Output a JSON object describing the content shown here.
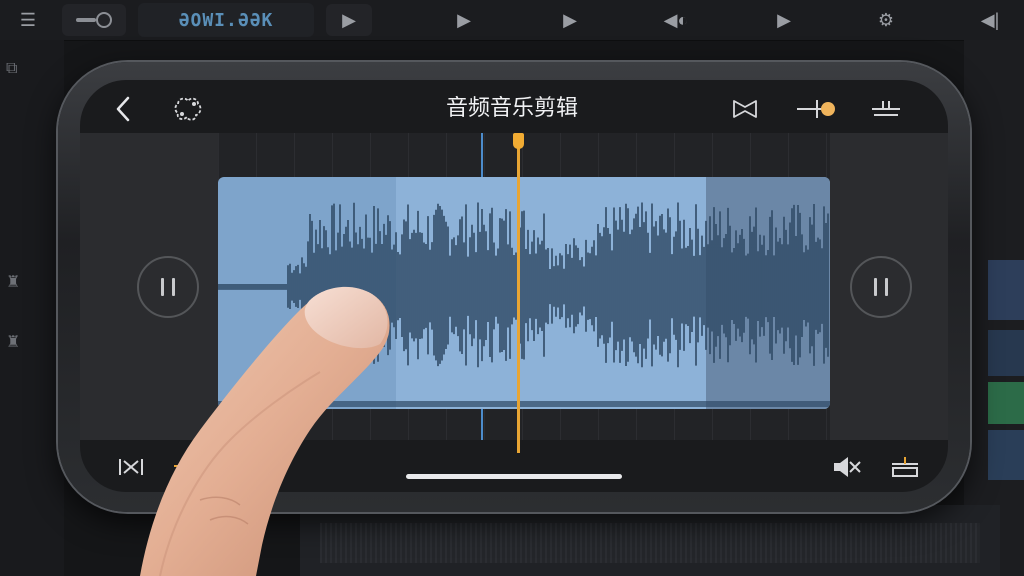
{
  "background_app": {
    "timecode_display": "ƏOWI.ƏƏK"
  },
  "phone_app": {
    "title": "音频音乐剪辑",
    "icons": {
      "back": "chevron-left-icon",
      "loop": "loop-icon",
      "trim": "trim-icon",
      "volume": "volume-slider-icon",
      "split": "split-icon",
      "cut": "cut-icon",
      "marker": "marker-icon",
      "mute": "speaker-icon",
      "insert": "insert-icon"
    },
    "accent_color": "#e8a534",
    "clip_color": "#7ea4cb",
    "selection_color": "#8db2d8"
  },
  "colors": {
    "phone_screen": "#1a1b1d",
    "track_background": "#222326",
    "waveform": "#2f4a66"
  }
}
